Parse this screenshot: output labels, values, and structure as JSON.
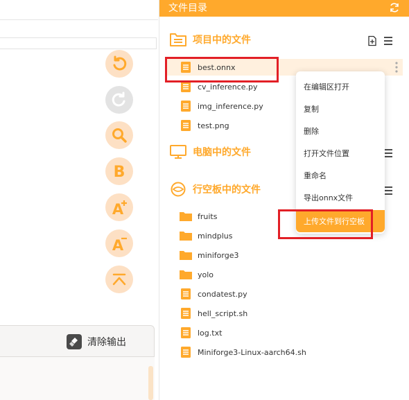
{
  "editor": {
    "toolbar": [
      {
        "name": "undo-button",
        "icon": "undo-icon",
        "enabled": true
      },
      {
        "name": "redo-button",
        "icon": "redo-icon",
        "enabled": false
      },
      {
        "name": "search-button",
        "icon": "search-icon",
        "enabled": true
      },
      {
        "name": "bold-button",
        "icon": "bold-b-icon",
        "enabled": true
      },
      {
        "name": "font-increase-button",
        "icon": "font-increase-icon",
        "enabled": true
      },
      {
        "name": "font-decrease-button",
        "icon": "font-decrease-icon",
        "enabled": true
      },
      {
        "name": "scroll-top-button",
        "icon": "scroll-to-top-icon",
        "enabled": true
      }
    ],
    "output": {
      "clear_label": "清除输出"
    }
  },
  "file_panel": {
    "title": "文件目录",
    "sections": {
      "project": {
        "label": "项目中的文件",
        "files": [
          "best.onnx",
          "cv_inference.py",
          "img_inference.py",
          "test.png"
        ],
        "selected": "best.onnx"
      },
      "computer": {
        "label": "电脑中的文件"
      },
      "board": {
        "label": "行空板中的文件",
        "folders": [
          "fruits",
          "mindplus",
          "miniforge3",
          "yolo"
        ],
        "files": [
          "condatest.py",
          "hell_script.sh",
          "log.txt",
          "Miniforge3-Linux-aarch64.sh"
        ]
      }
    }
  },
  "context_menu": {
    "items": [
      "在编辑区打开",
      "复制",
      "删除",
      "打开文件位置",
      "重命名",
      "导出onnx文件",
      "上传文件到行空板"
    ],
    "active": "上传文件到行空板"
  },
  "colors": {
    "accent": "#ffa92c",
    "tool_bg": "#fde0c4",
    "highlight": "#e21f26"
  }
}
